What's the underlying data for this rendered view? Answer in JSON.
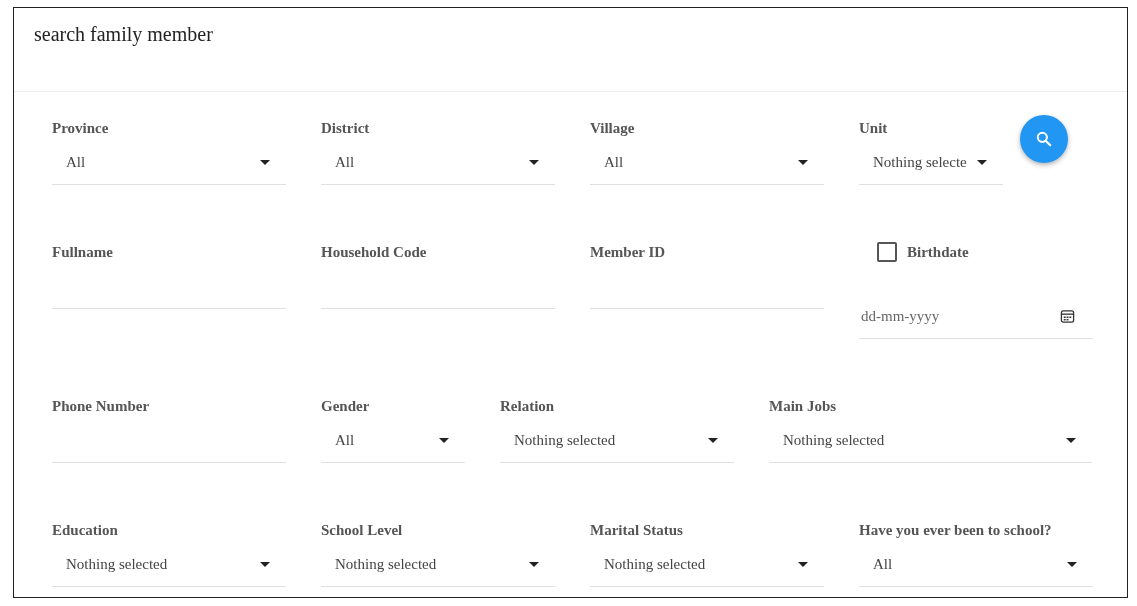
{
  "title": "search family member",
  "rows": [
    [
      {
        "label": "Province",
        "kind": "select",
        "value": "All"
      },
      {
        "label": "District",
        "kind": "select",
        "value": "All"
      },
      {
        "label": "Village",
        "kind": "select",
        "value": "All"
      },
      {
        "label": "Unit",
        "kind": "select",
        "value": "Nothing selecte"
      }
    ],
    [
      {
        "label": "Fullname",
        "kind": "text"
      },
      {
        "label": "Household Code",
        "kind": "text"
      },
      {
        "label": "Member ID",
        "kind": "text"
      },
      {
        "label": "Birthdate",
        "kind": "date",
        "checked": false,
        "placeholder": "dd-mm-yyyy"
      }
    ],
    [
      {
        "label": "Phone Number",
        "kind": "text"
      },
      {
        "label": "Gender",
        "kind": "select",
        "value": "All"
      },
      {
        "label": "Relation",
        "kind": "select",
        "value": "Nothing selected"
      },
      {
        "label": "Main Jobs",
        "kind": "select",
        "value": "Nothing selected"
      }
    ],
    [
      {
        "label": "Education",
        "kind": "select",
        "value": "Nothing selected"
      },
      {
        "label": "School Level",
        "kind": "select",
        "value": "Nothing selected"
      },
      {
        "label": "Marital Status",
        "kind": "select",
        "value": "Nothing selected"
      },
      {
        "label": "Have you ever been to school?",
        "kind": "select",
        "value": "All"
      }
    ]
  ]
}
